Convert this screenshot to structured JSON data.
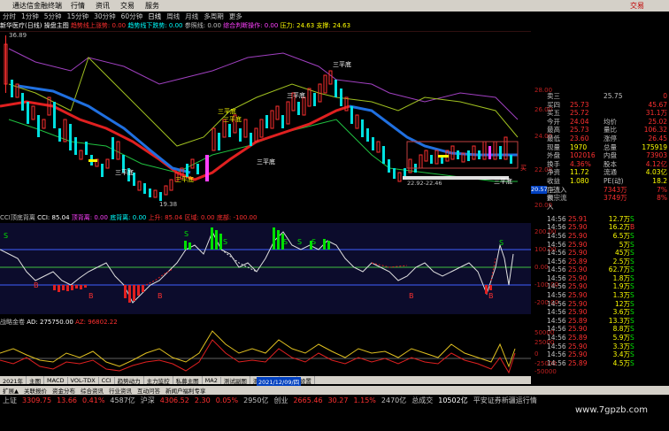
{
  "menubar": {
    "title": "通达信金融终端",
    "items": [
      "行情",
      "资讯",
      "交易",
      "服务"
    ],
    "brand": "交易"
  },
  "toolbar": {
    "items": [
      "分时",
      "1分钟",
      "5分钟",
      "15分钟",
      "30分钟",
      "60分钟",
      "日线",
      "周线",
      "月线",
      "多周期",
      "更多"
    ],
    "selected": "日线"
  },
  "indicator_header": {
    "stock": "新华医疗(日线)",
    "fields": [
      {
        "label": "操盘主图",
        "color": "#ffffff"
      },
      {
        "label": "趋势线上涨势: 0.00",
        "color": "#ff3030"
      },
      {
        "label": "趋势线下跌势: 0.00",
        "color": "#00ffff"
      },
      {
        "label": "参照线: 0.00",
        "color": "#c0c0c0"
      },
      {
        "label": "综合判断操作: 0.00",
        "color": "#ff40ff"
      },
      {
        "label": "压力: 24.63",
        "color": "#ffff00"
      },
      {
        "label": "支撑: 24.63",
        "color": "#ffff00"
      }
    ]
  },
  "main_chart": {
    "price_top_label": "36.89",
    "price_low_label": "19.38",
    "yaxis": [
      "28.00",
      "26.00",
      "24.00",
      "22.00",
      "20.00"
    ],
    "current_price_tag": "20.57",
    "annotations": [
      "三平底",
      "三平底",
      "三平底",
      "三平底",
      "三平底",
      "三平底",
      "三平底",
      "买",
      "三平底"
    ],
    "support_label": "22.92-22.46"
  },
  "cci_header": {
    "title": "CCI顶底背离",
    "cci": "CCI: 85.04",
    "top_div": "顶背离: 0.00",
    "bottom_div": "底背离: 0.00",
    "upper": "上升: 85.04",
    "lower": "区域: 0.00",
    "mid": "底部: -100.00"
  },
  "cci_chart": {
    "yaxis": [
      "200.00",
      "100.00",
      "0.00",
      "-100.00",
      "-200.00"
    ],
    "signals": [
      "S",
      "S",
      "S",
      "S",
      "S",
      "S",
      "B",
      "B",
      "B",
      "B",
      "S",
      "B"
    ]
  },
  "vol_header": {
    "title": "战略金卷",
    "ad": "AD: 275750.00",
    "az": "AZ: 96802.22"
  },
  "vol_chart": {
    "yaxis": [
      "50000",
      "25000",
      "0",
      "-25000",
      "-50000"
    ]
  },
  "bottom_tabs": [
    "2021年",
    "主图",
    "MACD",
    "VOL-TDX",
    "CCI",
    "趋势动力",
    "主力监控",
    "私募主图",
    "MA2",
    "测试副图",
    "测试主图",
    "更多",
    "设置"
  ],
  "bottom_date": "2021/12/09/四",
  "sub_tabs": [
    "扩展▲",
    "关联报价",
    "资金分布",
    "综合资讯",
    "行业资讯",
    "互动问答",
    "新闻户福利专享"
  ],
  "quote": {
    "rows": [
      {
        "k": "卖三",
        "v": "",
        "k2": "25.75",
        "v2": "0"
      },
      {
        "k": "买四",
        "v": "25.73",
        "k2": "",
        "v2": "45.67"
      },
      {
        "k": "买五",
        "v": "25.72",
        "k2": "",
        "v2": "31.1万"
      },
      {
        "k": "今开",
        "v": "24.04",
        "k2": "均价",
        "v2": "25.02"
      },
      {
        "k": "最高",
        "v": "25.73",
        "k2": "量比",
        "v2": "106.32"
      },
      {
        "k": "最低",
        "v": "23.60",
        "k2": "涨停",
        "v2": "26.45"
      },
      {
        "k": "现量",
        "v": "1970",
        "k2": "总量",
        "v2": "175919"
      },
      {
        "k": "外盘",
        "v": "102016",
        "k2": "内盘",
        "v2": "73903"
      },
      {
        "k": "换手",
        "v": "4.36%",
        "k2": "股本",
        "v2": "4.12亿"
      },
      {
        "k": "净资",
        "v": "11.72",
        "k2": "流通",
        "v2": "4.03亿"
      },
      {
        "k": "收益(三)",
        "v": "1.080",
        "k2": "PE(动)",
        "v2": "18.2"
      },
      {
        "k": "净流入额",
        "v": "",
        "k2": "7343万",
        "v2": "7%"
      },
      {
        "k": "大宗流入",
        "v": "",
        "k2": "3749万",
        "v2": "8%"
      }
    ],
    "ticks": [
      [
        "14:56",
        "25.91",
        "12.7万",
        "S"
      ],
      [
        "14:56",
        "25.90",
        "16.2万",
        "B"
      ],
      [
        "14:56",
        "25.90",
        "6.5万",
        "S"
      ],
      [
        "14:56",
        "25.90",
        "5万",
        "S"
      ],
      [
        "14:56",
        "25.90",
        "45万",
        "S"
      ],
      [
        "14:56",
        "25.89",
        "2.5万",
        "S"
      ],
      [
        "14:56",
        "25.90",
        "62.7万",
        "S"
      ],
      [
        "14:56",
        "25.90",
        "1.8万",
        "S"
      ],
      [
        "14:56",
        "25.90",
        "1.9万",
        "S"
      ],
      [
        "14:56",
        "25.90",
        "1.3万",
        "S"
      ],
      [
        "14:56",
        "25.90",
        "12万",
        "S"
      ],
      [
        "14:56",
        "25.90",
        "3.6万",
        "S"
      ],
      [
        "14:56",
        "25.89",
        "13.3万",
        "S"
      ],
      [
        "14:56",
        "25.90",
        "8.8万",
        "S"
      ],
      [
        "14:56",
        "25.89",
        "5.9万",
        "S"
      ],
      [
        "14:56",
        "25.90",
        "3.3万",
        "S"
      ],
      [
        "14:56",
        "25.90",
        "3.4万",
        "S"
      ],
      [
        "14:56",
        "25.89",
        "4.5万",
        "S"
      ],
      [
        "14:56",
        "25.90",
        "5.1万",
        "S"
      ],
      [
        "14:56",
        "25.89",
        "2.9万",
        "S"
      ],
      [
        "14:56",
        "25.89",
        "61.3万",
        "S"
      ],
      [
        "14:56",
        "25.89",
        "50.1万",
        "S"
      ],
      [
        "14:56",
        "25.89",
        "4.2万",
        "S"
      ],
      [
        "14:56",
        "25.90",
        "4.5万",
        "S"
      ],
      [
        "14:56",
        "25.90",
        "3.4万",
        "S"
      ],
      [
        "14:56",
        "25.89",
        "16万",
        "S"
      ],
      [
        "14:56",
        "25.89",
        "12万",
        "S"
      ],
      [
        "14:56",
        "25.89",
        "37.6万",
        "S"
      ],
      [
        "14:56",
        "25.89",
        "38.5万",
        "S"
      ],
      [
        "14:56",
        "25.89",
        "10.6万",
        "S"
      ],
      [
        "14:56",
        "25.90",
        "51.1万",
        "S"
      ],
      [
        "14:56",
        "25.90",
        "15.6万",
        "S"
      ]
    ]
  },
  "statusbar": [
    {
      "t": "上证",
      "c": "#c0c0c0"
    },
    {
      "t": "3309.75",
      "c": "#ff3030"
    },
    {
      "t": "13.66",
      "c": "#ff3030"
    },
    {
      "t": "0.41%",
      "c": "#ff3030"
    },
    {
      "t": "4587亿",
      "c": "#c0c0c0"
    },
    {
      "t": "沪深",
      "c": "#c0c0c0"
    },
    {
      "t": "4306.52",
      "c": "#ff3030"
    },
    {
      "t": "2.30",
      "c": "#ff3030"
    },
    {
      "t": "0.05%",
      "c": "#ff3030"
    },
    {
      "t": "2950亿",
      "c": "#c0c0c0"
    },
    {
      "t": "创业",
      "c": "#c0c0c0"
    },
    {
      "t": "2665.46",
      "c": "#ff3030"
    },
    {
      "t": "30.27",
      "c": "#ff3030"
    },
    {
      "t": "1.15%",
      "c": "#ff3030"
    },
    {
      "t": "2470亿",
      "c": "#c0c0c0"
    },
    {
      "t": "总成交",
      "c": "#c0c0c0"
    },
    {
      "t": "10502亿",
      "c": "#ffffff"
    },
    {
      "t": "平安证券新疆运行情",
      "c": "#c0c0c0"
    }
  ],
  "watermark": "www.7gpzb.com"
}
